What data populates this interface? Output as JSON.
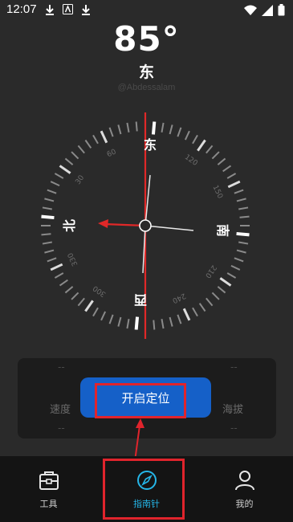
{
  "status": {
    "time": "12:07"
  },
  "compass": {
    "degree": "85°",
    "direction": "东",
    "watermark": "@Abdessalam",
    "cardinals": {
      "north": "北",
      "east": "东",
      "south": "南",
      "west": "西"
    },
    "degree_labels": [
      "30",
      "60",
      "120",
      "150",
      "210",
      "240",
      "300",
      "330"
    ]
  },
  "panel": {
    "labels": {
      "speed": "速度",
      "altitude": "海拔"
    },
    "values": {
      "top_left": "--",
      "top_right": "--",
      "bottom_left": "--",
      "bottom_right": "--"
    }
  },
  "locate_button": {
    "label": "开启定位"
  },
  "nav": {
    "items": [
      {
        "label": "工具",
        "icon": "toolbox-icon"
      },
      {
        "label": "指南针",
        "icon": "compass-icon"
      },
      {
        "label": "我的",
        "icon": "user-icon"
      }
    ]
  },
  "colors": {
    "accent": "#25b6e8",
    "button": "#1560c8",
    "highlight": "#e0242c",
    "needle": "#e02828"
  }
}
